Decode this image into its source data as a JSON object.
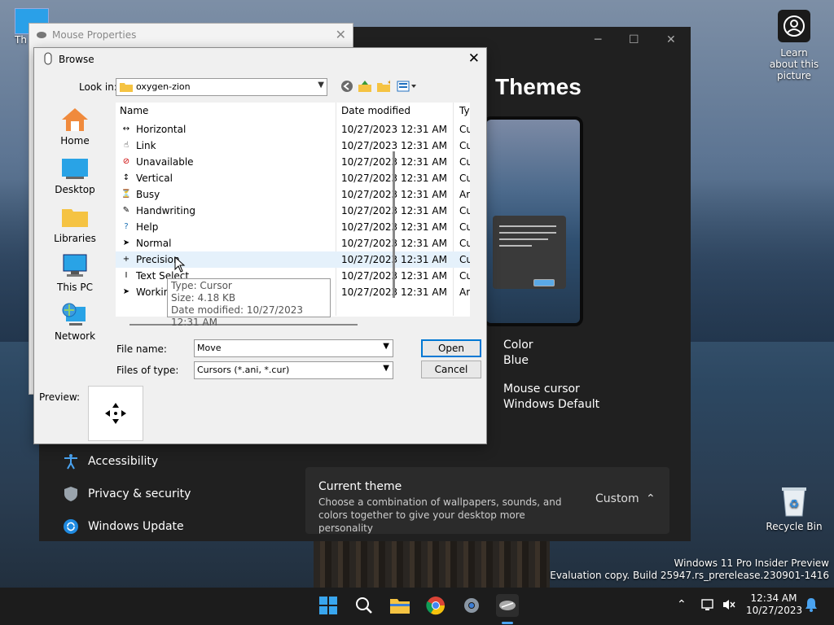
{
  "desktop": {
    "icon_top_left_label": "Th",
    "learn_label": "Learn about this picture",
    "recycle_label": "Recycle Bin",
    "watermark_line1": "Windows 11 Pro Insider Preview",
    "watermark_line2": "Evaluation copy. Build 25947.rs_prerelease.230901-1416"
  },
  "settings": {
    "title": "Themes",
    "color_label": "Color",
    "color_value": "Blue",
    "cursor_label": "Mouse cursor",
    "cursor_value": "Windows Default",
    "nav": [
      "Accessibility",
      "Privacy & security",
      "Windows Update"
    ],
    "current_theme_title": "Current theme",
    "current_theme_desc": "Choose a combination of wallpapers, sounds, and colors together to give your desktop more personality",
    "current_theme_value": "Custom"
  },
  "mouse_props": {
    "title": "Mouse Properties"
  },
  "browse": {
    "title": "Browse",
    "look_in_label": "Look in:",
    "look_in_value": "oxygen-zion",
    "places": [
      "Home",
      "Desktop",
      "Libraries",
      "This PC",
      "Network"
    ],
    "columns": {
      "name": "Name",
      "date": "Date modified",
      "type": "Ty"
    },
    "rows": [
      {
        "name": "Horizontal",
        "date": "10/27/2023 12:31 AM",
        "type": "Cu"
      },
      {
        "name": "Link",
        "date": "10/27/2023 12:31 AM",
        "type": "Cu"
      },
      {
        "name": "Unavailable",
        "date": "10/27/2023 12:31 AM",
        "type": "Cu"
      },
      {
        "name": "Vertical",
        "date": "10/27/2023 12:31 AM",
        "type": "Cu"
      },
      {
        "name": "Busy",
        "date": "10/27/2023 12:31 AM",
        "type": "Ar"
      },
      {
        "name": "Handwriting",
        "date": "10/27/2023 12:31 AM",
        "type": "Cu"
      },
      {
        "name": "Help",
        "date": "10/27/2023 12:31 AM",
        "type": "Cu"
      },
      {
        "name": "Normal",
        "date": "10/27/2023 12:31 AM",
        "type": "Cu"
      },
      {
        "name": "Precision",
        "date": "10/27/2023 12:31 AM",
        "type": "Cu"
      },
      {
        "name": "Text Select",
        "date": "10/27/2023 12:31 AM",
        "type": "Cu"
      },
      {
        "name": "Workin",
        "date": "10/27/2023 12:31 AM",
        "type": "Ar"
      }
    ],
    "tooltip": {
      "line1": "Type: Cursor",
      "line2": "Size: 4.18 KB",
      "line3": "Date modified: 10/27/2023 12:31 AM"
    },
    "file_name_label": "File name:",
    "file_name_value": "Move",
    "file_type_label": "Files of type:",
    "file_type_value": "Cursors (*.ani, *.cur)",
    "open_label": "Open",
    "cancel_label": "Cancel",
    "preview_label": "Preview:"
  },
  "taskbar": {
    "time": "12:34 AM",
    "date": "10/27/2023"
  },
  "colors": {
    "accent": "#0078d4",
    "settings_bg": "#202020",
    "taskbar_bg": "#1c1c1c"
  }
}
